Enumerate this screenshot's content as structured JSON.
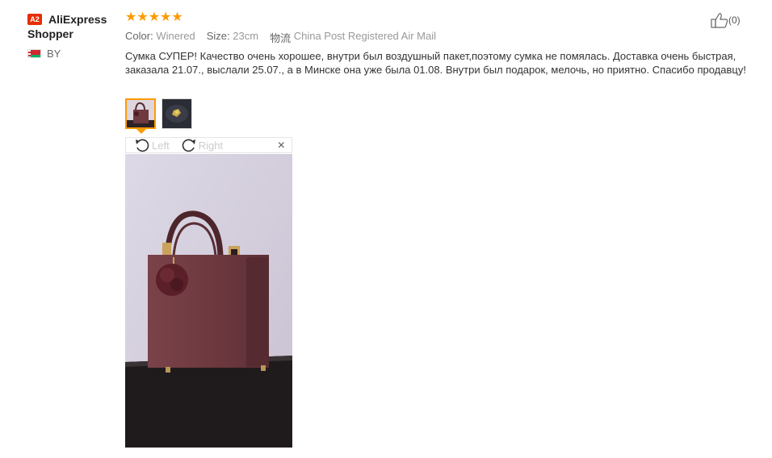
{
  "reviewer": {
    "level_badge": "A2",
    "name": "AliExpress Shopper",
    "country_code": "BY"
  },
  "rating": {
    "stars": 5
  },
  "product_meta": {
    "color_label": "Color:",
    "color_value": "Winered",
    "size_label": "Size:",
    "size_value": "23cm",
    "shipping_label": "物流",
    "shipping_value": "China Post Registered Air Mail"
  },
  "helpful": {
    "count": "(0)"
  },
  "review_text": "Сумка СУПЕР! Качество очень хорошее, внутри был воздушный пакет,поэтому сумка не помялась. Доставка очень быстрая, заказала 21.07., выслали 25.07., а в Минске она уже была 01.08. Внутри был подарок, мелочь, но приятно. Спасибо продавцу!",
  "viewer": {
    "rotate_left_label": "Left",
    "rotate_right_label": "Right",
    "close_label": "×"
  },
  "colors": {
    "accent": "#ff9a00",
    "badge": "#e62e04",
    "bag": "#6e3a40"
  }
}
